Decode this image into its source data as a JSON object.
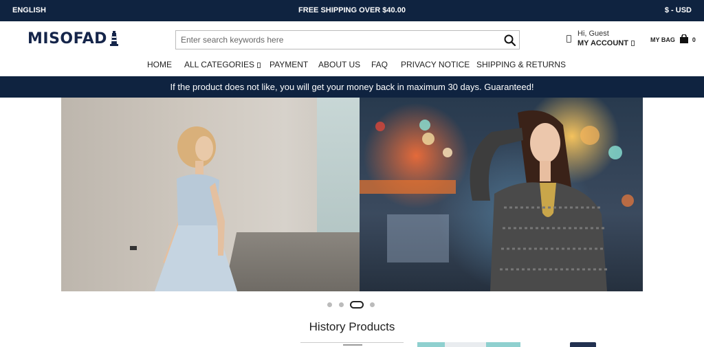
{
  "topbar": {
    "language": "ENGLISH",
    "shipping": "FREE SHIPPING OVER $40.00",
    "currency": "$ - USD"
  },
  "logo": {
    "text": "MISOFAD",
    "icon": "lighthouse-icon"
  },
  "search": {
    "placeholder": "Enter search keywords here",
    "value": "",
    "icon": "search-icon"
  },
  "account": {
    "greeting": "Hi, Guest",
    "label": "MY ACCOUNT"
  },
  "bag": {
    "label": "MY BAG",
    "count": "0",
    "icon": "shopping-bag-icon"
  },
  "nav": {
    "items": [
      {
        "label": "HOME"
      },
      {
        "label": "ALL CATEGORIES"
      },
      {
        "label": "PAYMENT"
      },
      {
        "label": "ABOUT US"
      },
      {
        "label": "FAQ"
      },
      {
        "label": "PRIVACY NOTICE"
      },
      {
        "label": "SHIPPING & RETURNS"
      }
    ]
  },
  "guarantee": "If the product does not like, you will get your money back in maximum 30 days. Guaranteed!",
  "slider": {
    "slide_count": 4,
    "active_index": 2
  },
  "history": {
    "title": "History Products"
  },
  "colors": {
    "navy": "#0f2340",
    "white": "#ffffff"
  }
}
